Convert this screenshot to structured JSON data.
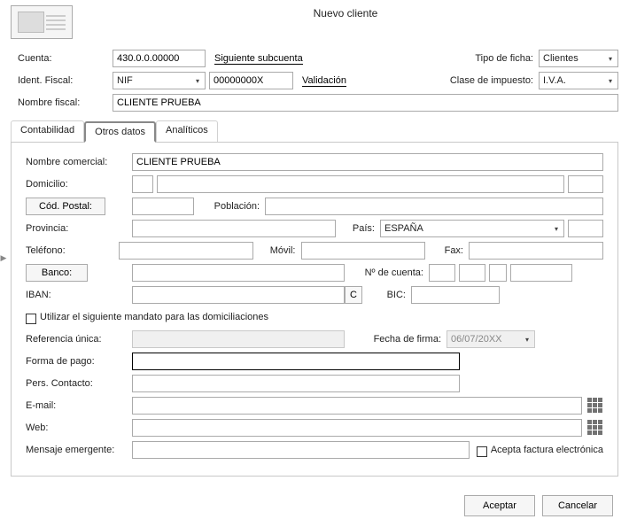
{
  "title": "Nuevo cliente",
  "top": {
    "cuenta_label": "Cuenta:",
    "cuenta_value": "430.0.0.00000",
    "siguiente_subcuenta": "Siguiente subcuenta",
    "ident_fiscal_label": "Ident. Fiscal:",
    "ident_fiscal_tipo": "NIF",
    "ident_fiscal_valor": "00000000X",
    "validacion": "Validación",
    "nombre_fiscal_label": "Nombre fiscal:",
    "nombre_fiscal_value": "CLIENTE PRUEBA",
    "tipo_ficha_label": "Tipo de ficha:",
    "tipo_ficha_value": "Clientes",
    "clase_imp_label": "Clase de impuesto:",
    "clase_imp_value": "I.V.A."
  },
  "tabs": {
    "t1": "Contabilidad",
    "t2": "Otros datos",
    "t3": "Analíticos"
  },
  "otros": {
    "nombre_comercial_label": "Nombre comercial:",
    "nombre_comercial_value": "CLIENTE PRUEBA",
    "domicilio_label": "Domicilio:",
    "cod_postal_btn": "Cód. Postal:",
    "poblacion_label": "Población:",
    "provincia_label": "Provincia:",
    "pais_label": "País:",
    "pais_value": "ESPAÑA",
    "telefono_label": "Teléfono:",
    "movil_label": "Móvil:",
    "fax_label": "Fax:",
    "banco_btn": "Banco:",
    "ncuenta_label": "Nº de cuenta:",
    "iban_label": "IBAN:",
    "c_btn": "C",
    "bic_label": "BIC:",
    "mandato_check": "Utilizar el siguiente mandato para las domiciliaciones",
    "ref_unica_label": "Referencia única:",
    "fecha_firma_label": "Fecha de firma:",
    "fecha_firma_value": "06/07/20XX",
    "forma_pago_label": "Forma de pago:",
    "pers_contacto_label": "Pers. Contacto:",
    "email_label": "E-mail:",
    "web_label": "Web:",
    "mensaje_label": "Mensaje emergente:",
    "acepta_factura": "Acepta factura electrónica"
  },
  "footer": {
    "aceptar": "Aceptar",
    "cancelar": "Cancelar"
  }
}
